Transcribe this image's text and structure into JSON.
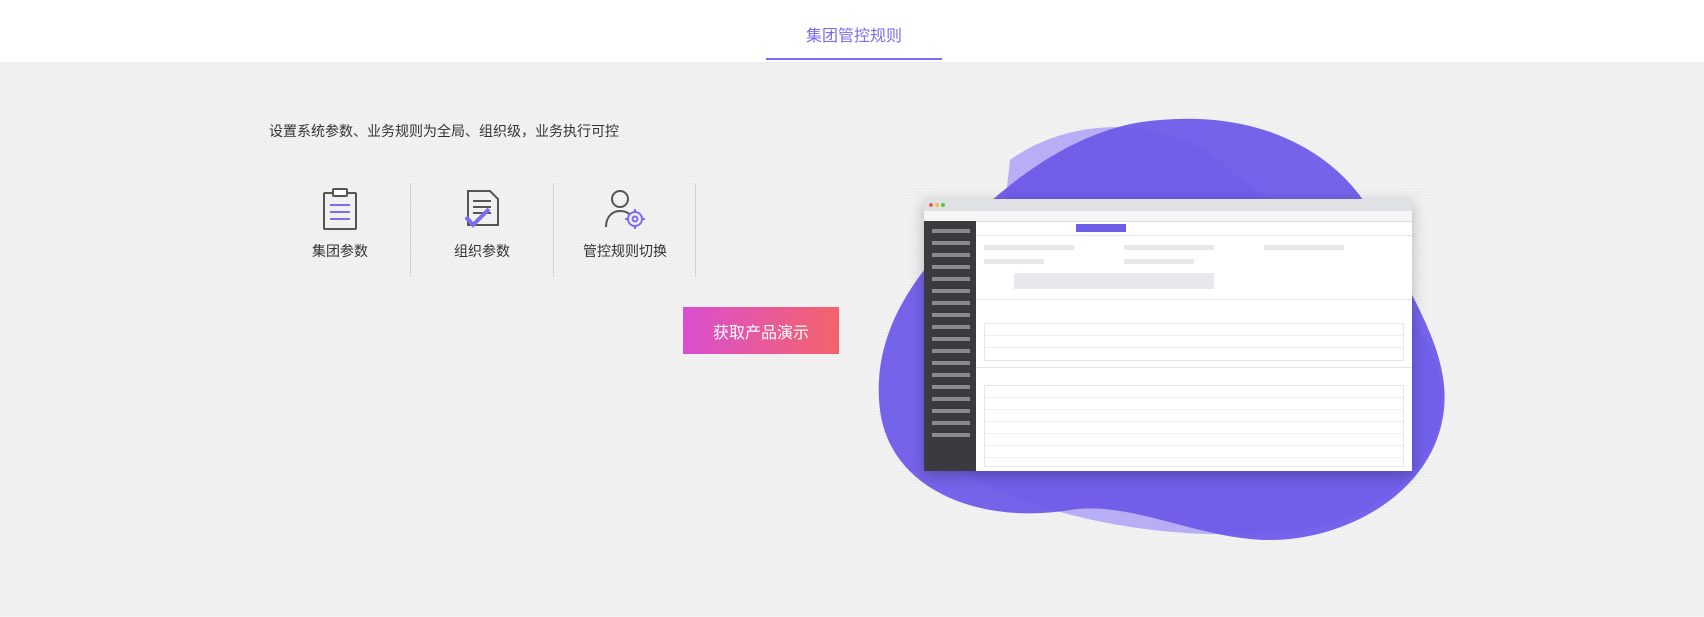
{
  "tabs": {
    "active_label": "集团管控规则"
  },
  "main": {
    "description": "设置系统参数、业务规则为全局、组织级，业务执行可控",
    "features": [
      {
        "label": "集团参数",
        "icon": "clipboard-icon"
      },
      {
        "label": "组织参数",
        "icon": "document-check-icon"
      },
      {
        "label": "管控规则切换",
        "icon": "user-gear-icon"
      }
    ],
    "demo_button": "获取产品演示"
  },
  "colors": {
    "accent": "#7b6cf0",
    "blob_dark": "#6a58e8",
    "blob_light": "#b8aef6",
    "button_start": "#d94fcf",
    "button_end": "#f4636a"
  }
}
